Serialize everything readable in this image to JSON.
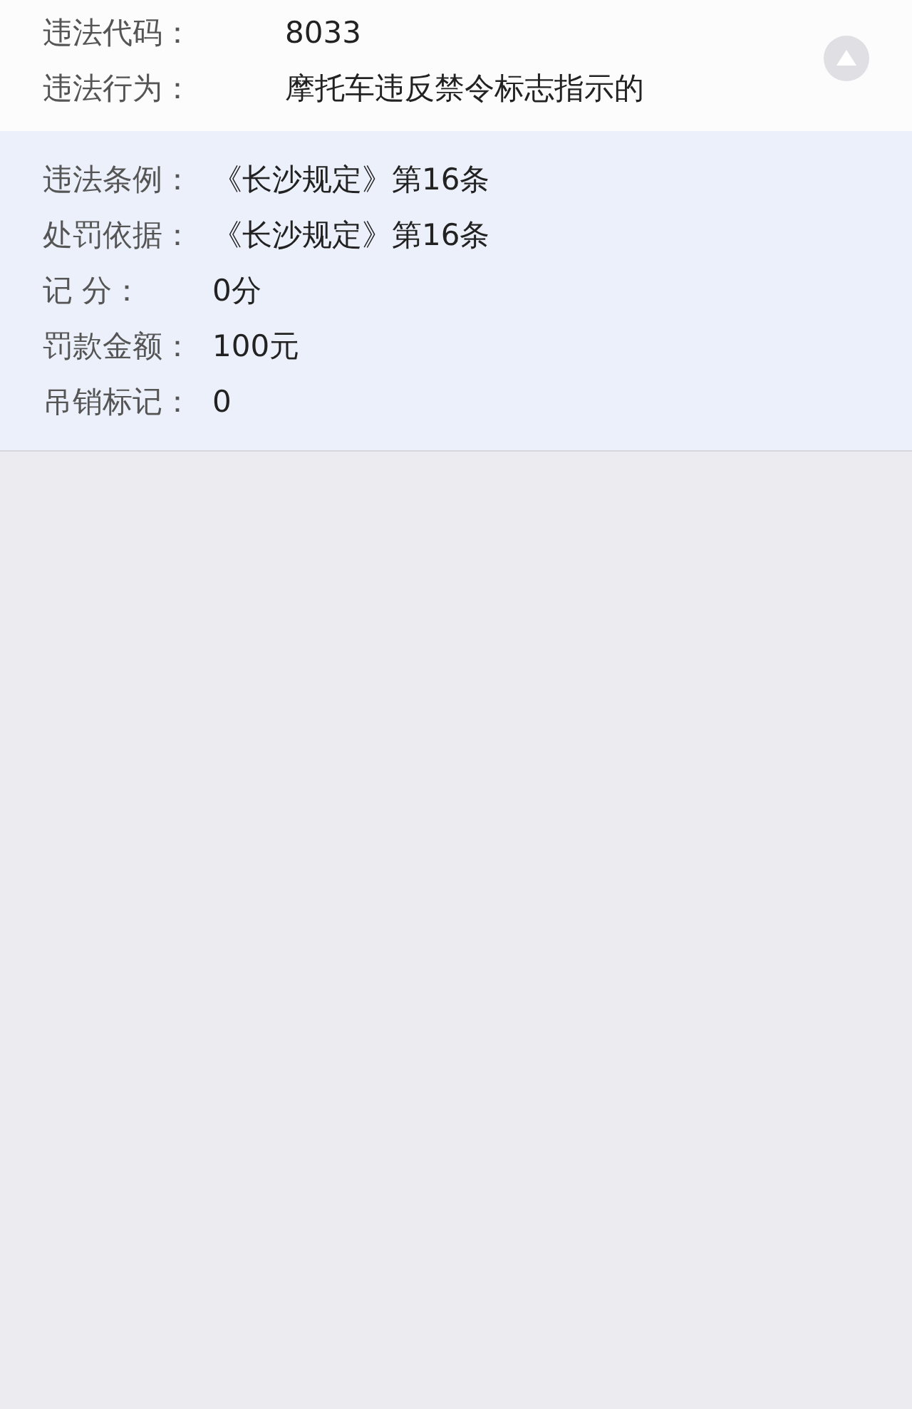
{
  "summary": {
    "rows": [
      {
        "label": "违法代码：",
        "value": "8033"
      },
      {
        "label": "违法行为：",
        "value": "摩托车违反禁令标志指示的"
      }
    ],
    "toggle": {
      "expanded": true
    }
  },
  "details": {
    "rows": [
      {
        "label": "违法条例：",
        "value": "《长沙规定》第16条"
      },
      {
        "label": "处罚依据：",
        "value": "《长沙规定》第16条"
      },
      {
        "label": "记 分：",
        "value": "0分"
      },
      {
        "label": "罚款金额：",
        "value": "100元"
      },
      {
        "label": "吊销标记：",
        "value": "0"
      }
    ]
  }
}
